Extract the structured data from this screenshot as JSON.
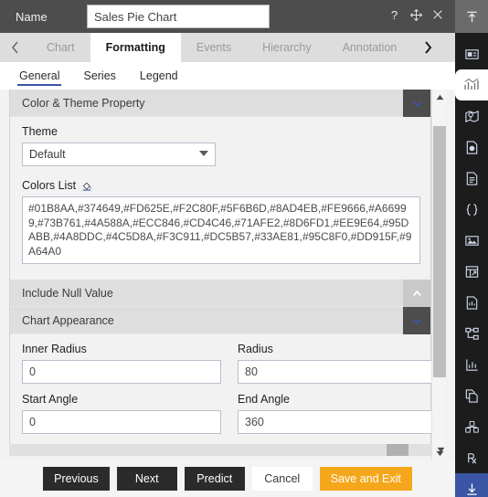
{
  "titlebar": {
    "name_label": "Name",
    "name_value": "Sales Pie Chart",
    "name_placeholder": "Name",
    "help_icon": "question-mark-icon",
    "move_icon": "move-icon",
    "close_icon": "close-icon",
    "pin_icon": "collapse-up-icon"
  },
  "tabs": {
    "prev_label": "‹",
    "next_label": "›",
    "items": [
      {
        "label": "Chart",
        "active": false
      },
      {
        "label": "Formatting",
        "active": true
      },
      {
        "label": "Events",
        "active": false
      },
      {
        "label": "Hierarchy",
        "active": false
      },
      {
        "label": "Annotation",
        "active": false
      }
    ]
  },
  "subtabs": {
    "items": [
      {
        "label": "General",
        "active": true
      },
      {
        "label": "Series",
        "active": false
      },
      {
        "label": "Legend",
        "active": false
      }
    ]
  },
  "sections": {
    "color_theme": {
      "title": "Color & Theme Property",
      "toggle_icon": "chevron-down-icon",
      "theme_label": "Theme",
      "theme_value": "Default",
      "theme_options": [
        "Default"
      ],
      "colors_list_label": "Colors List",
      "colors_picker_icon": "paint-bucket-icon",
      "colors_value": "#01B8AA,#374649,#FD625E,#F2C80F,#5F6B6D,#8AD4EB,#FE9666,#A66999,#73B761,#4A588A,#ECC846,#CD4C46,#71AFE2,#8D6FD1,#EE9E64,#95DABB,#4A8DDC,#4C5D8A,#F3C911,#DC5B57,#33AE81,#95C8F0,#DD915F,#9A64A0"
    },
    "include_null": {
      "title": "Include Null Value",
      "toggle_icon": "chevron-up-icon"
    },
    "chart_appearance": {
      "title": "Chart Appearance",
      "toggle_icon": "chevron-down-icon",
      "fields": [
        {
          "label": "Inner Radius",
          "value": "0",
          "name": "inner-radius-input"
        },
        {
          "label": "Radius",
          "value": "80",
          "name": "radius-input"
        },
        {
          "label": "Start Angle",
          "value": "0",
          "name": "start-angle-input"
        },
        {
          "label": "End Angle",
          "value": "360",
          "name": "end-angle-input"
        }
      ]
    }
  },
  "scrollbars": {
    "v_up_icon": "scroll-up-arrow-icon",
    "v_down_icon": "scroll-down-arrow-icon",
    "h_right_icon": "scroll-right-arrow-icon"
  },
  "footer": {
    "buttons": [
      {
        "label": "Previous",
        "style": "dark",
        "name": "previous-button"
      },
      {
        "label": "Next",
        "style": "dark",
        "name": "next-button"
      },
      {
        "label": "Predict",
        "style": "dark",
        "name": "predict-button"
      },
      {
        "label": "Cancel",
        "style": "light",
        "name": "cancel-button"
      },
      {
        "label": "Save and Exit",
        "style": "warn",
        "name": "save-and-exit-button"
      }
    ]
  },
  "rail": {
    "items": [
      {
        "icon": "panel-layout-icon",
        "state": "normal"
      },
      {
        "icon": "bar-chart-icon",
        "state": "selected"
      },
      {
        "icon": "map-pin-icon",
        "state": "normal"
      },
      {
        "icon": "document-gauge-icon",
        "state": "normal"
      },
      {
        "icon": "document-lines-icon",
        "state": "normal"
      },
      {
        "icon": "code-braces-icon",
        "state": "normal"
      },
      {
        "icon": "image-icon",
        "state": "normal"
      },
      {
        "icon": "table-grid-icon",
        "state": "normal"
      },
      {
        "icon": "document-data-icon",
        "state": "normal"
      },
      {
        "icon": "hierarchy-tree-icon",
        "state": "normal"
      },
      {
        "icon": "line-chart-icon",
        "state": "normal"
      },
      {
        "icon": "copy-pages-icon",
        "state": "normal"
      },
      {
        "icon": "cubes-icon",
        "state": "normal"
      },
      {
        "icon": "rx-prescription-icon",
        "state": "normal"
      },
      {
        "icon": "download-arrow-icon",
        "state": "active"
      }
    ]
  },
  "colors": {
    "accent_blue": "#3b55a5",
    "warn_orange": "#f5a71b",
    "titlebar_gray": "#4d4d4d",
    "rail_dark": "#1c1c1c"
  }
}
